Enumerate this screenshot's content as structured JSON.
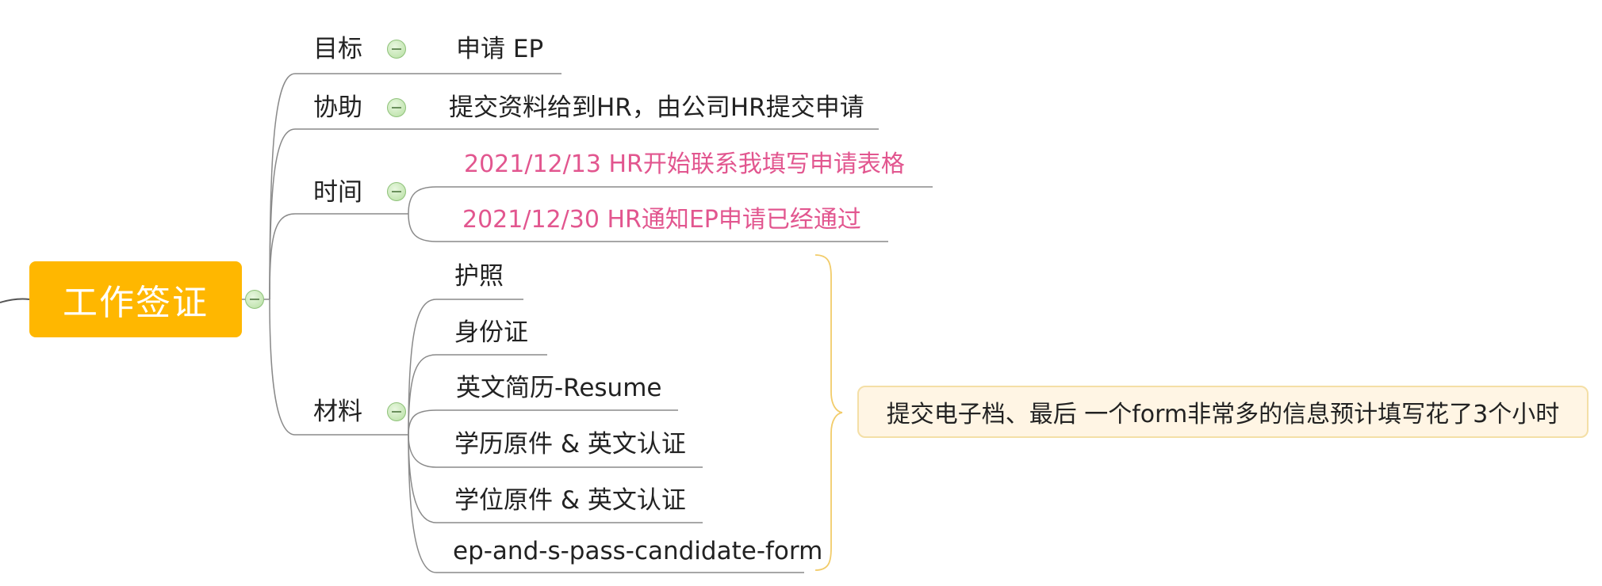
{
  "mindmap": {
    "root": {
      "label": "工作签证"
    },
    "branches": [
      {
        "label": "目标",
        "children": [
          {
            "label": "申请 EP"
          }
        ]
      },
      {
        "label": "协助",
        "children": [
          {
            "label": "提交资料给到HR，由公司HR提交申请"
          }
        ]
      },
      {
        "label": "时间",
        "children": [
          {
            "label": "2021/12/13  HR开始联系我填写申请表格"
          },
          {
            "label": "2021/12/30  HR通知EP申请已经通过"
          }
        ]
      },
      {
        "label": "材料",
        "children": [
          {
            "label": "护照"
          },
          {
            "label": "身份证"
          },
          {
            "label": "英文简历-Resume"
          },
          {
            "label": "学历原件 & 英文认证"
          },
          {
            "label": "学位原件 & 英文认证"
          },
          {
            "label": "ep-and-s-pass-candidate-form"
          }
        ],
        "summary": {
          "label": "提交电子档、最后 一个form非常多的信息预计填写花了3个小时"
        }
      }
    ]
  },
  "colors": {
    "root_fill": "#ffb700",
    "root_text": "#ffffff",
    "date_text": "#e2568f",
    "line": "#8a8a8a",
    "brace": "#f2cc6a",
    "summary_fill": "#fff5e4",
    "summary_border": "#f4dfa6",
    "toggle_fill": "#c5e6b4"
  }
}
